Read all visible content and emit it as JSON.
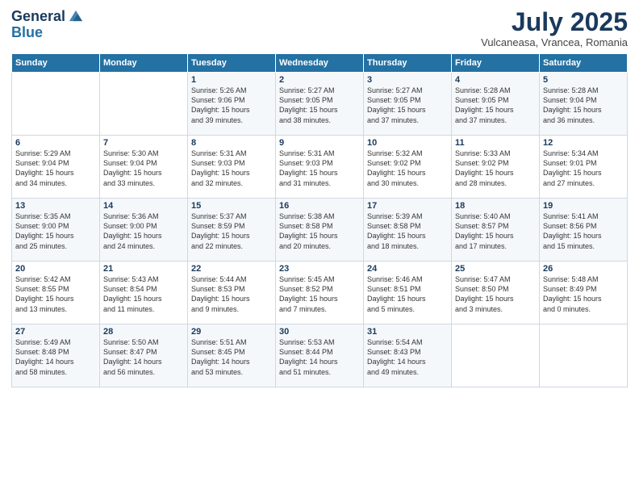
{
  "header": {
    "logo_line1": "General",
    "logo_line2": "Blue",
    "month": "July 2025",
    "location": "Vulcaneasa, Vrancea, Romania"
  },
  "days_of_week": [
    "Sunday",
    "Monday",
    "Tuesday",
    "Wednesday",
    "Thursday",
    "Friday",
    "Saturday"
  ],
  "weeks": [
    [
      {
        "day": "",
        "lines": []
      },
      {
        "day": "",
        "lines": []
      },
      {
        "day": "1",
        "lines": [
          "Sunrise: 5:26 AM",
          "Sunset: 9:06 PM",
          "Daylight: 15 hours",
          "and 39 minutes."
        ]
      },
      {
        "day": "2",
        "lines": [
          "Sunrise: 5:27 AM",
          "Sunset: 9:05 PM",
          "Daylight: 15 hours",
          "and 38 minutes."
        ]
      },
      {
        "day": "3",
        "lines": [
          "Sunrise: 5:27 AM",
          "Sunset: 9:05 PM",
          "Daylight: 15 hours",
          "and 37 minutes."
        ]
      },
      {
        "day": "4",
        "lines": [
          "Sunrise: 5:28 AM",
          "Sunset: 9:05 PM",
          "Daylight: 15 hours",
          "and 37 minutes."
        ]
      },
      {
        "day": "5",
        "lines": [
          "Sunrise: 5:28 AM",
          "Sunset: 9:04 PM",
          "Daylight: 15 hours",
          "and 36 minutes."
        ]
      }
    ],
    [
      {
        "day": "6",
        "lines": [
          "Sunrise: 5:29 AM",
          "Sunset: 9:04 PM",
          "Daylight: 15 hours",
          "and 34 minutes."
        ]
      },
      {
        "day": "7",
        "lines": [
          "Sunrise: 5:30 AM",
          "Sunset: 9:04 PM",
          "Daylight: 15 hours",
          "and 33 minutes."
        ]
      },
      {
        "day": "8",
        "lines": [
          "Sunrise: 5:31 AM",
          "Sunset: 9:03 PM",
          "Daylight: 15 hours",
          "and 32 minutes."
        ]
      },
      {
        "day": "9",
        "lines": [
          "Sunrise: 5:31 AM",
          "Sunset: 9:03 PM",
          "Daylight: 15 hours",
          "and 31 minutes."
        ]
      },
      {
        "day": "10",
        "lines": [
          "Sunrise: 5:32 AM",
          "Sunset: 9:02 PM",
          "Daylight: 15 hours",
          "and 30 minutes."
        ]
      },
      {
        "day": "11",
        "lines": [
          "Sunrise: 5:33 AM",
          "Sunset: 9:02 PM",
          "Daylight: 15 hours",
          "and 28 minutes."
        ]
      },
      {
        "day": "12",
        "lines": [
          "Sunrise: 5:34 AM",
          "Sunset: 9:01 PM",
          "Daylight: 15 hours",
          "and 27 minutes."
        ]
      }
    ],
    [
      {
        "day": "13",
        "lines": [
          "Sunrise: 5:35 AM",
          "Sunset: 9:00 PM",
          "Daylight: 15 hours",
          "and 25 minutes."
        ]
      },
      {
        "day": "14",
        "lines": [
          "Sunrise: 5:36 AM",
          "Sunset: 9:00 PM",
          "Daylight: 15 hours",
          "and 24 minutes."
        ]
      },
      {
        "day": "15",
        "lines": [
          "Sunrise: 5:37 AM",
          "Sunset: 8:59 PM",
          "Daylight: 15 hours",
          "and 22 minutes."
        ]
      },
      {
        "day": "16",
        "lines": [
          "Sunrise: 5:38 AM",
          "Sunset: 8:58 PM",
          "Daylight: 15 hours",
          "and 20 minutes."
        ]
      },
      {
        "day": "17",
        "lines": [
          "Sunrise: 5:39 AM",
          "Sunset: 8:58 PM",
          "Daylight: 15 hours",
          "and 18 minutes."
        ]
      },
      {
        "day": "18",
        "lines": [
          "Sunrise: 5:40 AM",
          "Sunset: 8:57 PM",
          "Daylight: 15 hours",
          "and 17 minutes."
        ]
      },
      {
        "day": "19",
        "lines": [
          "Sunrise: 5:41 AM",
          "Sunset: 8:56 PM",
          "Daylight: 15 hours",
          "and 15 minutes."
        ]
      }
    ],
    [
      {
        "day": "20",
        "lines": [
          "Sunrise: 5:42 AM",
          "Sunset: 8:55 PM",
          "Daylight: 15 hours",
          "and 13 minutes."
        ]
      },
      {
        "day": "21",
        "lines": [
          "Sunrise: 5:43 AM",
          "Sunset: 8:54 PM",
          "Daylight: 15 hours",
          "and 11 minutes."
        ]
      },
      {
        "day": "22",
        "lines": [
          "Sunrise: 5:44 AM",
          "Sunset: 8:53 PM",
          "Daylight: 15 hours",
          "and 9 minutes."
        ]
      },
      {
        "day": "23",
        "lines": [
          "Sunrise: 5:45 AM",
          "Sunset: 8:52 PM",
          "Daylight: 15 hours",
          "and 7 minutes."
        ]
      },
      {
        "day": "24",
        "lines": [
          "Sunrise: 5:46 AM",
          "Sunset: 8:51 PM",
          "Daylight: 15 hours",
          "and 5 minutes."
        ]
      },
      {
        "day": "25",
        "lines": [
          "Sunrise: 5:47 AM",
          "Sunset: 8:50 PM",
          "Daylight: 15 hours",
          "and 3 minutes."
        ]
      },
      {
        "day": "26",
        "lines": [
          "Sunrise: 5:48 AM",
          "Sunset: 8:49 PM",
          "Daylight: 15 hours",
          "and 0 minutes."
        ]
      }
    ],
    [
      {
        "day": "27",
        "lines": [
          "Sunrise: 5:49 AM",
          "Sunset: 8:48 PM",
          "Daylight: 14 hours",
          "and 58 minutes."
        ]
      },
      {
        "day": "28",
        "lines": [
          "Sunrise: 5:50 AM",
          "Sunset: 8:47 PM",
          "Daylight: 14 hours",
          "and 56 minutes."
        ]
      },
      {
        "day": "29",
        "lines": [
          "Sunrise: 5:51 AM",
          "Sunset: 8:45 PM",
          "Daylight: 14 hours",
          "and 53 minutes."
        ]
      },
      {
        "day": "30",
        "lines": [
          "Sunrise: 5:53 AM",
          "Sunset: 8:44 PM",
          "Daylight: 14 hours",
          "and 51 minutes."
        ]
      },
      {
        "day": "31",
        "lines": [
          "Sunrise: 5:54 AM",
          "Sunset: 8:43 PM",
          "Daylight: 14 hours",
          "and 49 minutes."
        ]
      },
      {
        "day": "",
        "lines": []
      },
      {
        "day": "",
        "lines": []
      }
    ]
  ]
}
